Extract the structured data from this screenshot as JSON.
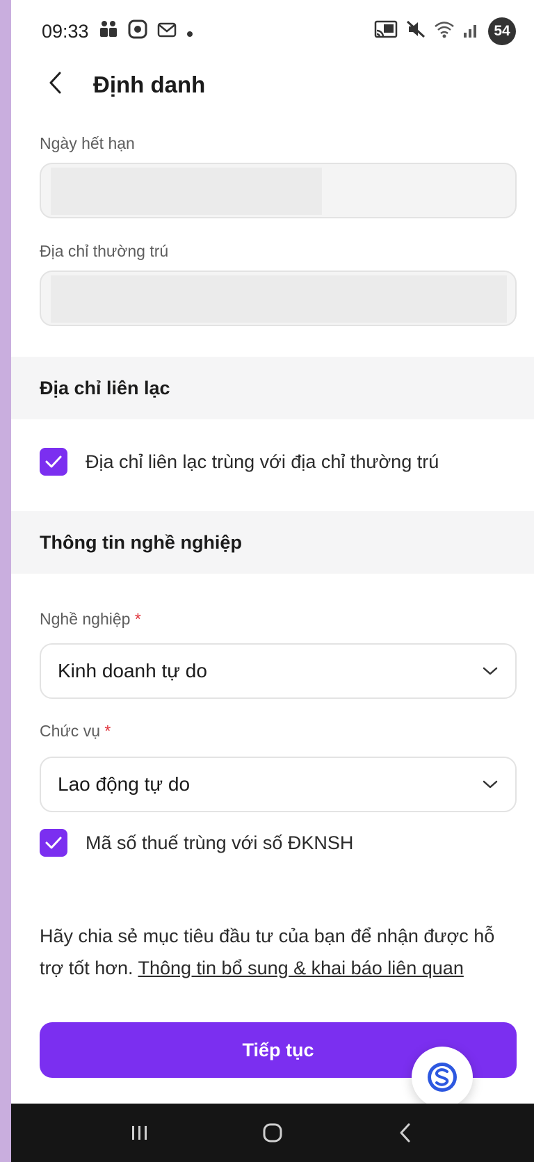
{
  "status_bar": {
    "time": "09:33",
    "battery": "54"
  },
  "header": {
    "title": "Định danh"
  },
  "fields": {
    "expiry_label": "Ngày hết hạn",
    "address_label": "Địa chỉ thường trú"
  },
  "contact_section": {
    "title": "Địa chỉ liên lạc",
    "same_address_label": "Địa chỉ liên lạc trùng với địa chỉ thường trú",
    "same_address_checked": true
  },
  "career_section": {
    "title": "Thông tin nghề nghiệp",
    "occupation_label": "Nghề nghiệp",
    "occupation_value": "Kinh doanh tự do",
    "position_label": "Chức vụ",
    "position_value": "Lao động tự do",
    "required_mark": "*",
    "tax_label": "Mã số thuế trùng với số ĐKNSH",
    "tax_checked": true
  },
  "footer": {
    "text": "Hãy chia sẻ mục tiêu đầu tư của bạn để nhận được hỗ trợ tốt hơn. ",
    "link": "Thông tin bổ sung & khai báo liên quan",
    "button": "Tiếp tục"
  },
  "colors": {
    "accent": "#7b2ff0",
    "required": "#e0313a",
    "section_bg": "#f5f5f6"
  },
  "icons": {
    "back": "chevron-left-icon",
    "dropdown": "chevron-down-icon",
    "check": "check-icon",
    "fab": "support-chat-icon"
  }
}
